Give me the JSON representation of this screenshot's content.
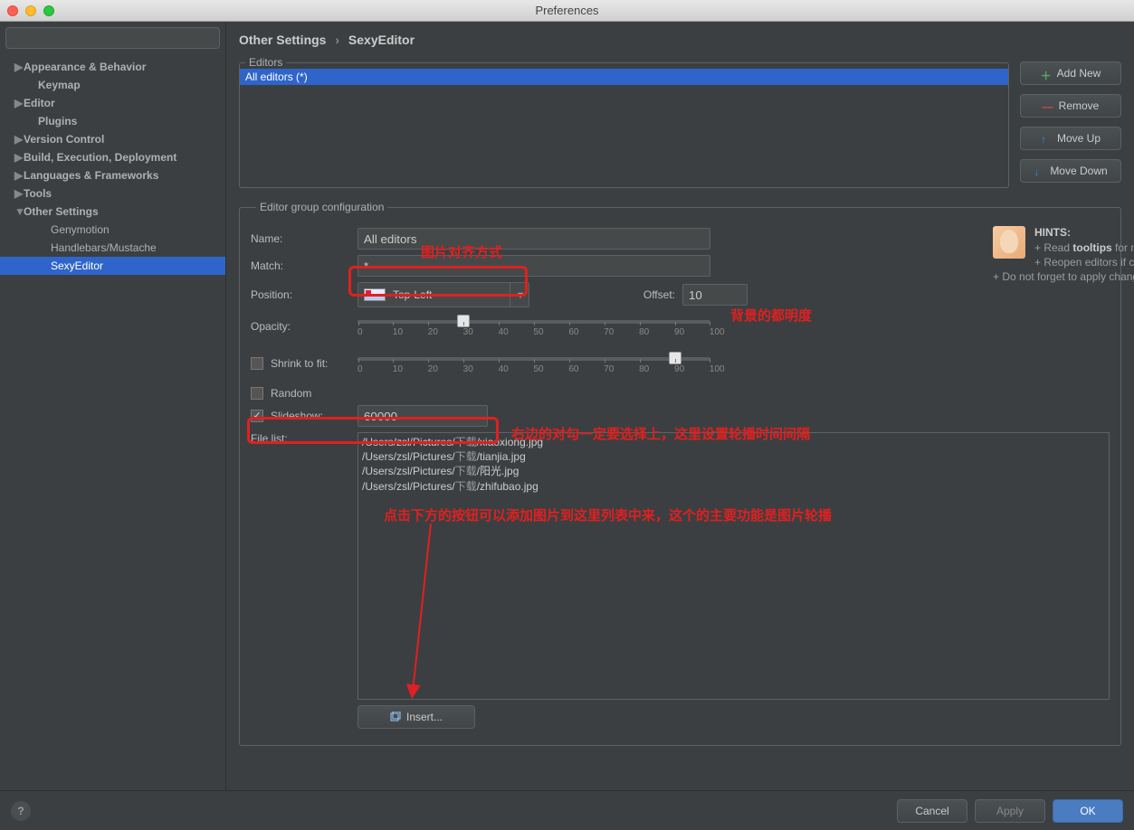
{
  "window": {
    "title": "Preferences"
  },
  "search": {
    "placeholder": ""
  },
  "sidebar": [
    {
      "label": "Appearance & Behavior",
      "arrow": "▶",
      "level": 1
    },
    {
      "label": "Keymap",
      "arrow": "",
      "level": 1,
      "indent": true
    },
    {
      "label": "Editor",
      "arrow": "▶",
      "level": 1
    },
    {
      "label": "Plugins",
      "arrow": "",
      "level": 1,
      "indent": true
    },
    {
      "label": "Version Control",
      "arrow": "▶",
      "level": 1
    },
    {
      "label": "Build, Execution, Deployment",
      "arrow": "▶",
      "level": 1
    },
    {
      "label": "Languages & Frameworks",
      "arrow": "▶",
      "level": 1
    },
    {
      "label": "Tools",
      "arrow": "▶",
      "level": 1
    },
    {
      "label": "Other Settings",
      "arrow": "▼",
      "level": 1
    },
    {
      "label": "Genymotion",
      "arrow": "",
      "level": 2
    },
    {
      "label": "Handlebars/Mustache",
      "arrow": "",
      "level": 2
    },
    {
      "label": "SexyEditor",
      "arrow": "",
      "level": 2,
      "selected": true
    }
  ],
  "breadcrumb": {
    "root": "Other Settings",
    "leaf": "SexyEditor"
  },
  "editors_fs": {
    "legend": "Editors",
    "rows": [
      "All editors (*)"
    ]
  },
  "buttons": {
    "add": "Add New",
    "remove": "Remove",
    "moveup": "Move Up",
    "movedown": "Move Down"
  },
  "config": {
    "legend": "Editor group configuration",
    "name_lbl": "Name:",
    "name_val": "All editors",
    "match_lbl": "Match:",
    "match_val": "*",
    "position_lbl": "Position:",
    "position_val": "Top-Left",
    "offset_lbl": "Offset:",
    "offset_val": "10",
    "opacity_lbl": "Opacity:",
    "opacity_val": 30,
    "shrink_lbl": "Shrink to fit:",
    "shrink_val": 90,
    "shrink_checked": false,
    "random_lbl": "Random",
    "random_checked": false,
    "slideshow_lbl": "Slideshow:",
    "slideshow_checked": true,
    "slideshow_val": "60000",
    "filelist_lbl": "File list:",
    "ticks": [
      "0",
      "10",
      "20",
      "30",
      "40",
      "50",
      "60",
      "70",
      "80",
      "90",
      "100"
    ],
    "hints_hdr": "HINTS:",
    "hints1a": "+ Read ",
    "hints1b": "tooltips",
    "hints1c": " for more help.",
    "hints2": "+ Reopen editors if changes are not visible.",
    "hints3": "+ Do not forget to apply changes before changing the editor group.",
    "files": [
      {
        "pre": "/Users/zsl/Pictures/",
        "cn": "下载",
        "post": "/xiaoxiong.jpg"
      },
      {
        "pre": "/Users/zsl/Pictures/",
        "cn": "下载",
        "post": "/tianjia.jpg"
      },
      {
        "pre": "/Users/zsl/Pictures/",
        "cn": "下载",
        "post": "/阳光.jpg"
      },
      {
        "pre": "/Users/zsl/Pictures/",
        "cn": "下载",
        "post": "/zhifubao.jpg"
      }
    ],
    "insert_lbl": "Insert..."
  },
  "annotations": {
    "a1": "图片对齐方式",
    "a2": "背景的都明度",
    "a3": "右边的对勾一定要选择上，这里设置轮播时间间隔",
    "a4": "点击下方的按钮可以添加图片到这里列表中来，这个的主要功能是图片轮播"
  },
  "footer": {
    "cancel": "Cancel",
    "apply": "Apply",
    "ok": "OK"
  }
}
